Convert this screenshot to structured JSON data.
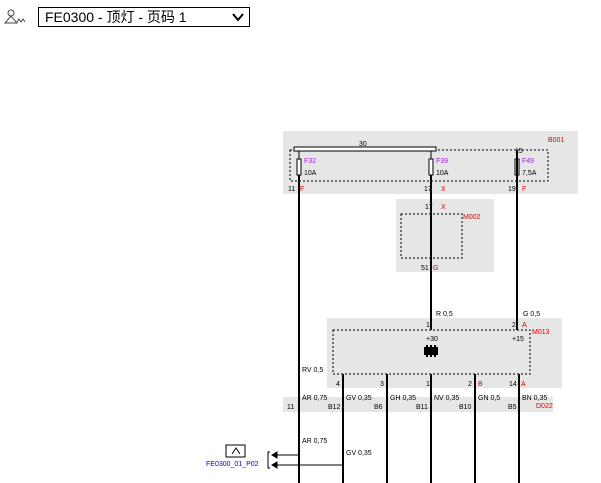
{
  "toolbar": {
    "icon": "diagram-tools-icon",
    "selector_value": "FE0300 - 顶灯 - 页码 1",
    "chevron_icon": "chevron-down-icon"
  },
  "colors": {
    "component_label": "#e00000",
    "fuse_label": "#a020f0",
    "link_label": "#0000c0",
    "box_fill": "#e6e6e6"
  },
  "diagram": {
    "b001": {
      "label": "B001",
      "bus": "30",
      "bus15": "15",
      "fuses": [
        {
          "name": "F32",
          "rating": "10A",
          "pin": "11",
          "conn": "F"
        },
        {
          "name": "F39",
          "rating": "10A",
          "pin": "17",
          "conn": "X"
        },
        {
          "name": "F49",
          "rating": "7,5A",
          "pin": "19",
          "conn": "F"
        }
      ]
    },
    "m002": {
      "label": "M002",
      "pin_in": "17",
      "conn_in": "X",
      "pin_out": "51",
      "conn_out": "G"
    },
    "wires_top": {
      "w1": "R 0,5",
      "w2": "G 0,5"
    },
    "m013": {
      "label": "M013",
      "plus30": "+30",
      "plus15": "+15",
      "pin_in1": "1",
      "conn_in1": "X",
      "pin_in2": "2",
      "conn_in2": "A",
      "bottom_pins": [
        {
          "pin": "4",
          "conn": ""
        },
        {
          "pin": "3",
          "conn": ""
        },
        {
          "pin": "1",
          "conn": ""
        },
        {
          "pin": "2",
          "conn": "B"
        },
        {
          "pin": "14",
          "conn": "A"
        }
      ]
    },
    "wire_left": "RV 0,5",
    "d022": {
      "label": "D022",
      "wires": [
        "AR 0,75",
        "GV 0,35",
        "GH 0,35",
        "NV 0,35",
        "GN 0,5",
        "BN 0,35"
      ],
      "pins": [
        "11",
        "B12",
        "B6",
        "B11",
        "B10",
        "B5"
      ]
    },
    "bottom": {
      "w1": "AR 0,75",
      "w2": "GV 0,35",
      "link": "FE0300_01_P02"
    }
  }
}
